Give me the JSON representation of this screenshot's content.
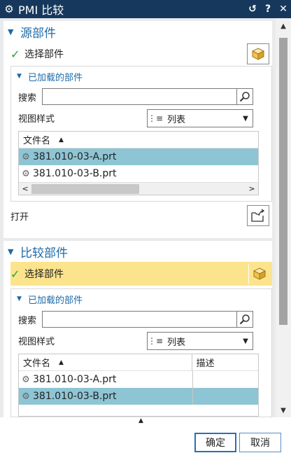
{
  "window": {
    "title": "PMI 比较",
    "icon": "gear-icon"
  },
  "source_section": {
    "title": "源部件",
    "select_label": "选择部件",
    "loaded_title": "已加载的部件",
    "search_label": "搜索",
    "search_value": "",
    "view_label": "视图样式",
    "view_value": "列表",
    "col_filename": "文件名",
    "files": [
      "381.010-03-A.prt",
      "381.010-03-B.prt"
    ],
    "selected_index": 0,
    "open_label": "打开"
  },
  "compare_section": {
    "title": "比较部件",
    "select_label": "选择部件",
    "loaded_title": "已加载的部件",
    "search_label": "搜索",
    "search_value": "",
    "view_label": "视图样式",
    "view_value": "列表",
    "col_filename": "文件名",
    "col_desc": "描述",
    "files": [
      "381.010-03-A.prt",
      "381.010-03-B.prt"
    ],
    "selected_index": 1
  },
  "footer": {
    "ok_label": "确定",
    "cancel_label": "取消"
  },
  "colors": {
    "titlebar": "#16385c",
    "accent": "#1e6aa8",
    "selection": "#8ec5d4",
    "highlight": "#fce48c"
  }
}
